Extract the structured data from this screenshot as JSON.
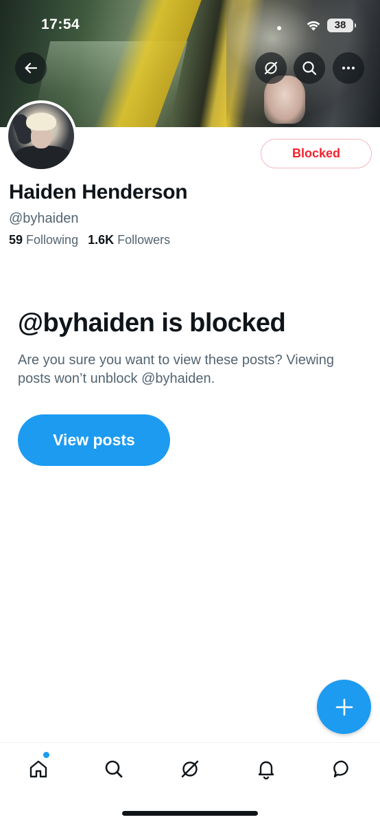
{
  "status_bar": {
    "time": "17:54",
    "battery": "38"
  },
  "banner": {
    "description_icons": [
      "back-arrow-icon",
      "grok-icon",
      "search-icon",
      "more-icon"
    ]
  },
  "profile": {
    "display_name": "Haiden Henderson",
    "handle": "@byhaiden",
    "following_count": "59",
    "following_label": "Following",
    "followers_count": "1.6K",
    "followers_label": "Followers",
    "relationship_button": "Blocked"
  },
  "blocked_notice": {
    "title": "@byhaiden is blocked",
    "description": "Are you sure you want to view these posts? Viewing posts won’t unblock @byhaiden.",
    "view_button": "View posts"
  },
  "tab_bar": {
    "items": [
      "home-icon",
      "search-icon",
      "grok-icon",
      "notifications-icon",
      "messages-icon"
    ],
    "active": "home-icon"
  },
  "colors": {
    "accent": "#1d9bf0",
    "blocked_red": "#f4212e",
    "text_primary": "#0f1419",
    "text_secondary": "#536471"
  }
}
